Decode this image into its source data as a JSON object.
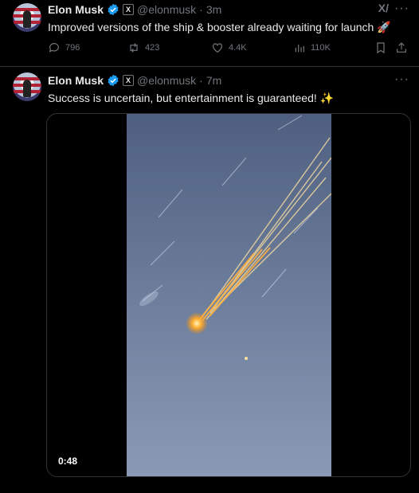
{
  "tweets": [
    {
      "author": "Elon Musk",
      "handle": "@elonmusk",
      "separator": "·",
      "time": "3m",
      "text": "Improved versions of the ship & booster already waiting for launch 🚀",
      "stats": {
        "replies": "796",
        "reposts": "423",
        "likes": "4.4K",
        "views": "110K"
      }
    },
    {
      "author": "Elon Musk",
      "handle": "@elonmusk",
      "separator": "·",
      "time": "7m",
      "text": "Success is uncertain, but entertainment is guaranteed! ✨",
      "media": {
        "duration": "0:48"
      }
    }
  ],
  "badge": {
    "affiliate_letter": "X"
  },
  "icons": {
    "verified": "verified-badge-icon",
    "more": "more-icon",
    "grok": "grok-icon",
    "reply": "reply-icon",
    "repost": "repost-icon",
    "like": "heart-icon",
    "views": "views-icon",
    "bookmark": "bookmark-icon",
    "share": "share-icon"
  },
  "colors": {
    "background": "#000000",
    "text": "#e7e9ea",
    "muted": "#71767b",
    "verified": "#1d9bf0",
    "divider": "#2f3336"
  }
}
